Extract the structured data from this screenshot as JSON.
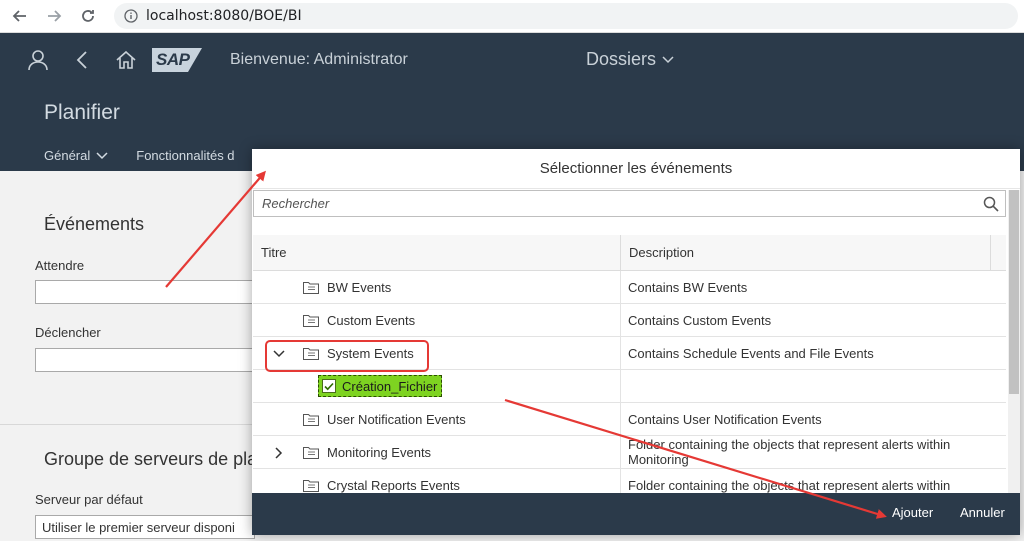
{
  "browser": {
    "url": "localhost:8080/BOE/BI"
  },
  "shell": {
    "logo": "SAP",
    "welcome": "Bienvenue: Administrator",
    "folders_menu": "Dossiers"
  },
  "page": {
    "title": "Planifier",
    "tabs": [
      "Général",
      "Fonctionnalités d"
    ]
  },
  "form": {
    "events_title": "Événements",
    "wait_label": "Attendre",
    "trigger_label": "Déclencher",
    "server_group_title": "Groupe de serveurs de pla",
    "default_server_label": "Serveur par défaut",
    "default_server_value": "Utiliser le premier serveur disponi"
  },
  "dialog": {
    "title": "Sélectionner les événements",
    "search_placeholder": "Rechercher",
    "columns": {
      "title": "Titre",
      "description": "Description"
    },
    "rows": [
      {
        "title": "BW Events",
        "description": "Contains BW Events",
        "expander": ""
      },
      {
        "title": "Custom Events",
        "description": "Contains Custom Events",
        "expander": ""
      },
      {
        "title": "System Events",
        "description": "Contains Schedule Events and File Events",
        "expander": "expanded"
      },
      {
        "title": "Création_Fichier",
        "description": "",
        "expander": "",
        "selected": true
      },
      {
        "title": "User Notification Events",
        "description": "Contains User Notification Events",
        "expander": ""
      },
      {
        "title": "Monitoring Events",
        "description": "Folder containing the objects that represent alerts within Monitoring",
        "expander": "collapsed"
      },
      {
        "title": "Crystal Reports Events",
        "description": "Folder containing the objects that represent alerts within",
        "expander": ""
      }
    ],
    "add_button": "Ajouter",
    "cancel_button": "Annuler"
  },
  "colors": {
    "shell_bg": "#2b3a4a",
    "selection_green": "#7ed321",
    "annotation_red": "#e53935"
  }
}
